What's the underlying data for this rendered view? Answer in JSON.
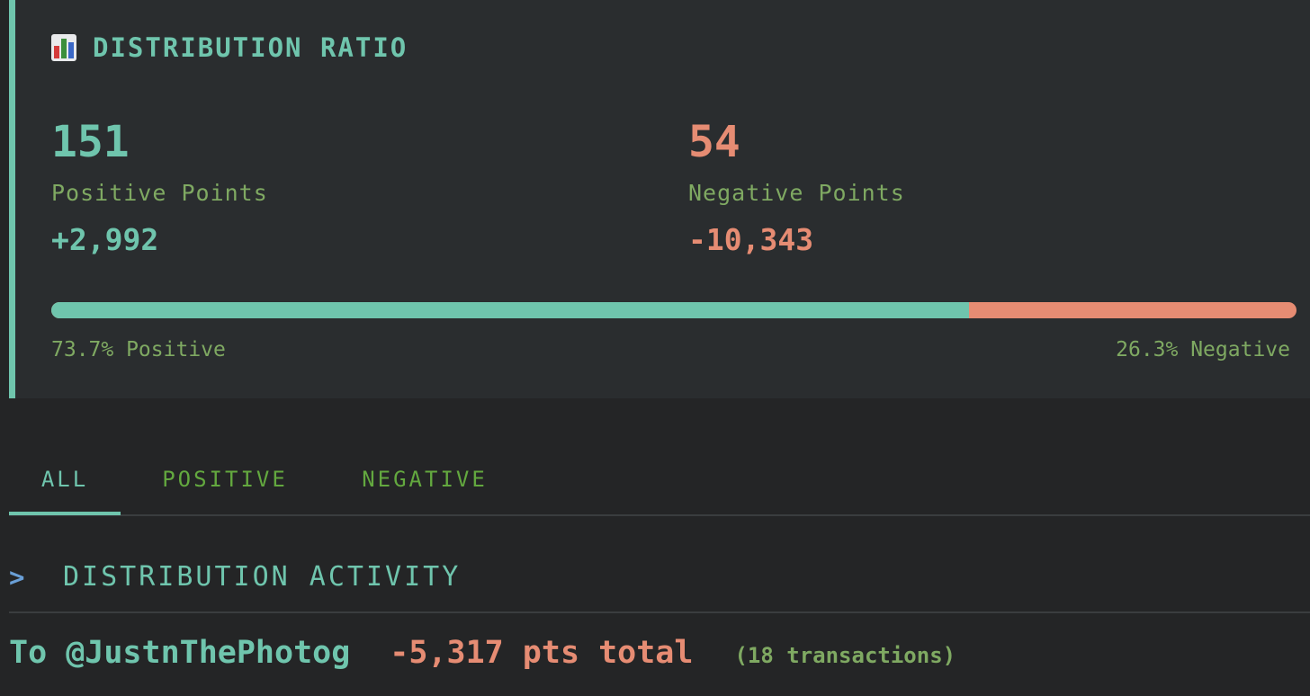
{
  "ratio_card": {
    "icon": "bar-chart-icon",
    "title": "DISTRIBUTION RATIO",
    "positive": {
      "count": "151",
      "label": "Positive Points",
      "sum": "+2,992"
    },
    "negative": {
      "count": "54",
      "label": "Negative Points",
      "sum": "-10,343"
    },
    "bar": {
      "positive_fraction": 0.737,
      "positive_label": "73.7% Positive",
      "negative_label": "26.3% Negative"
    }
  },
  "tabs": [
    {
      "label": "ALL",
      "active": true
    },
    {
      "label": "POSITIVE",
      "active": false
    },
    {
      "label": "NEGATIVE",
      "active": false
    }
  ],
  "activity": {
    "chevron": ">",
    "title": "DISTRIBUTION ACTIVITY",
    "rows": [
      {
        "recipient": "To @JustnThePhotog",
        "total": "-5,317 pts total",
        "transactions": "(18 transactions)"
      }
    ]
  },
  "colors": {
    "positive": "#6fc5ad",
    "negative": "#e68c73",
    "muted_green": "#7fa962",
    "tab_green": "#63a83f",
    "chevron_blue": "#6a9fd6",
    "card_bg": "#2a2d2f",
    "page_bg": "#242526"
  }
}
